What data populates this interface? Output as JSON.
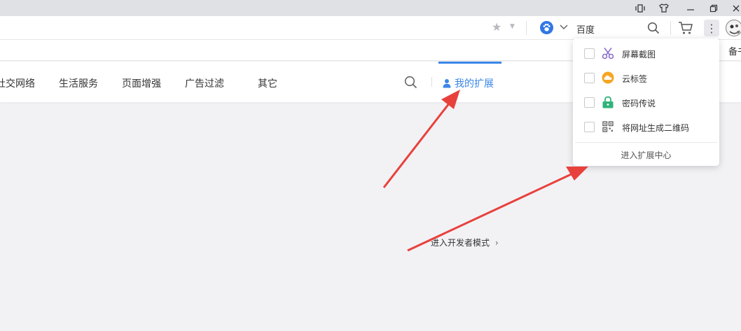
{
  "titlebar": {
    "icons": [
      "mini-mode-icon",
      "skin-icon",
      "minimize-icon",
      "restore-icon",
      "close-icon"
    ]
  },
  "addressbar": {
    "search_engine": "百度",
    "icons": [
      "star-icon",
      "baidu-paw-icon",
      "chevron-down-icon",
      "search-icon",
      "cart-icon",
      "menu-dots-icon",
      "avatar-icon"
    ]
  },
  "bookmarks": {
    "partial_text": "备书签"
  },
  "categories": {
    "items": [
      "社交网络",
      "生活服务",
      "页面增强",
      "广告过滤",
      "其它"
    ],
    "my_extensions": "我的扩展"
  },
  "main": {
    "dev_mode_link": "进入开发者模式",
    "dev_mode_chevron": "›"
  },
  "dropdown": {
    "items": [
      {
        "label": "屏幕截图",
        "icon": "scissors-icon"
      },
      {
        "label": "云标签",
        "icon": "cloud-icon"
      },
      {
        "label": "密码传说",
        "icon": "lock-icon"
      },
      {
        "label": "将网址生成二维码",
        "icon": "qrcode-icon"
      }
    ],
    "footer": "进入扩展中心"
  },
  "colors": {
    "accent": "#3a86e8",
    "arrow": "#e8413c",
    "background": "#f2f2f5"
  }
}
